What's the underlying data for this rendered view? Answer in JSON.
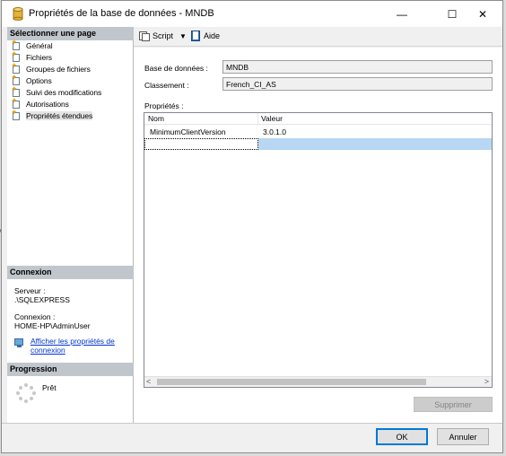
{
  "window": {
    "title": "Propriétés de la base de données - MNDB",
    "minimize_glyph": "—",
    "maximize_glyph": "☐",
    "close_glyph": "✕"
  },
  "left_panel": {
    "select_page_header": "Sélectionner une page",
    "pages": [
      {
        "label": "Général",
        "selected": false
      },
      {
        "label": "Fichiers",
        "selected": false
      },
      {
        "label": "Groupes de fichiers",
        "selected": false
      },
      {
        "label": "Options",
        "selected": false
      },
      {
        "label": "Suivi des modifications",
        "selected": false
      },
      {
        "label": "Autorisations",
        "selected": false
      },
      {
        "label": "Propriétés étendues",
        "selected": true
      }
    ],
    "connection_header": "Connexion",
    "server_label": "Serveur :",
    "server_value": ".\\SQLEXPRESS",
    "connection_label": "Connexion :",
    "connection_value": "HOME-HP\\AdminUser",
    "view_connection_link": "Afficher les propriétés de connexion",
    "progress_header": "Progression",
    "progress_status": "Prêt"
  },
  "toolbar": {
    "script_label": "Script",
    "script_dropdown_glyph": "▼",
    "help_label": "Aide"
  },
  "content": {
    "database_label": "Base de données :",
    "database_value": "MNDB",
    "collation_label": "Classement :",
    "collation_value": "French_CI_AS",
    "properties_label": "Propriétés :",
    "grid": {
      "columns": [
        "Nom",
        "Valeur"
      ],
      "rows": [
        {
          "name": "MinimumClientVersion",
          "value": "3.0.1.0"
        }
      ]
    },
    "scroll_left_glyph": "<",
    "scroll_right_glyph": ">",
    "delete_button": "Supprimer"
  },
  "footer": {
    "ok_button": "OK",
    "cancel_button": "Annuler"
  },
  "edge_fragment": "%",
  "colors": {
    "section_header_bg": "#c0c6cc",
    "selection_blue": "#b7d7f2",
    "link_blue": "#0033cc",
    "primary_border": "#0078d7"
  }
}
